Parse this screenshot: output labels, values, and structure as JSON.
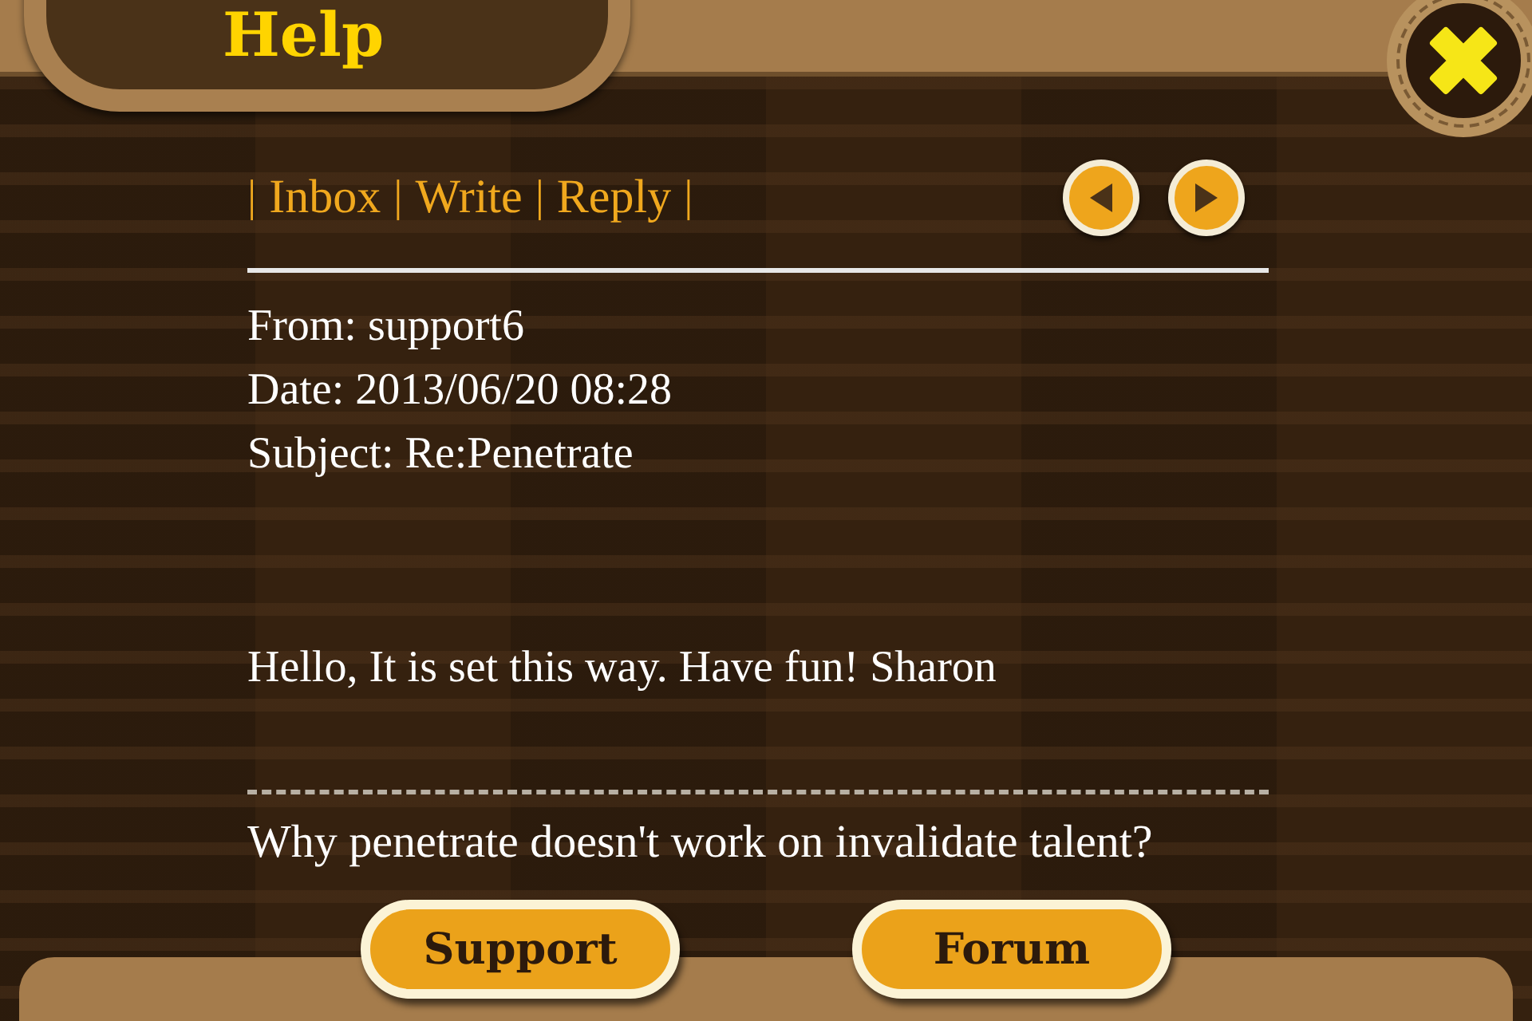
{
  "title": "Help",
  "nav": {
    "separator": "|",
    "links": [
      {
        "label": "Inbox"
      },
      {
        "label": "Write"
      },
      {
        "label": "Reply"
      }
    ]
  },
  "message": {
    "from": "From: support6",
    "date": "Date: 2013/06/20 08:28",
    "subject": "Subject: Re:Penetrate",
    "body": "Hello, It is set this way. Have fun! Sharon",
    "question": "Why penetrate doesn't work on invalidate talent?"
  },
  "buttons": [
    "Support",
    "Forum"
  ]
}
